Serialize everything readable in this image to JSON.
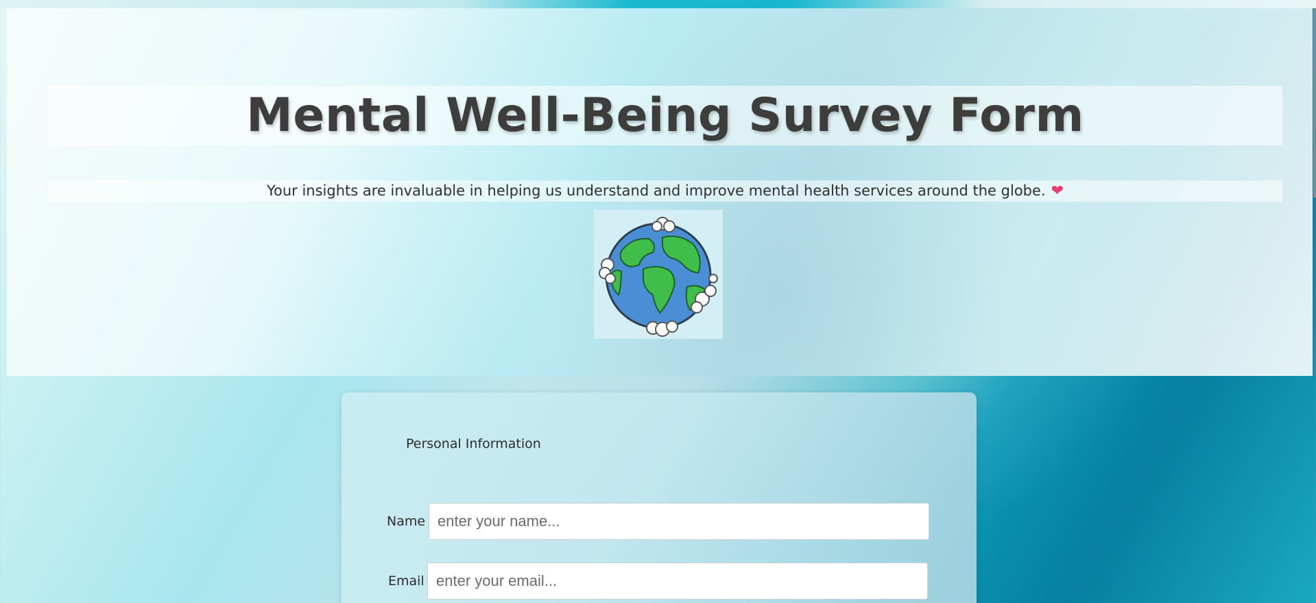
{
  "page": {
    "title": "Mental Well-Being Survey Form",
    "subtitle": "Your insights are invaluable in helping us understand and improve mental health services around the globe.",
    "heart_emoji": "❤",
    "hero_image": "globe-illustration"
  },
  "form": {
    "section_title": "Personal Information",
    "fields": [
      {
        "label": "Name",
        "placeholder": "enter your name..."
      },
      {
        "label": "Email",
        "placeholder": "enter your email..."
      }
    ]
  },
  "colors": {
    "title_text": "#3d3d3d",
    "heart": "#e83e6c",
    "globe_ocean": "#4a8fd6",
    "globe_land": "#3fbf4a"
  }
}
